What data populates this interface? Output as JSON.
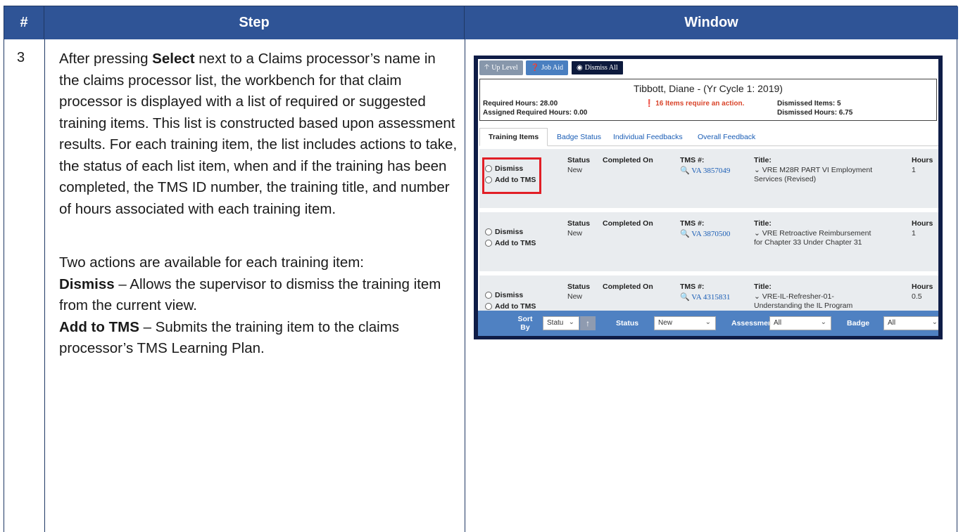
{
  "table": {
    "headers": {
      "num": "#",
      "step": "Step",
      "window": "Window"
    },
    "row_number": "3",
    "step": {
      "p1_a": "After pressing ",
      "p1_bold": "Select",
      "p1_b": " next to a Claims processor’s name in the claims processor list, the workbench for that claim processor is displayed with a list of required or suggested training items. This list is constructed based upon assessment results. For each training item, the list includes actions to take, the status of each list item, when and if the training has been completed, the TMS ID number, the training title, and number of hours associated with each training item.",
      "p2": "Two actions are available for each training item:",
      "dismiss_bold": "Dismiss",
      "dismiss_text": " – Allows the supervisor to dismiss the training item from the current view.",
      "addtms_bold": "Add to TMS",
      "addtms_text": " – Submits the training item to the claims processor’s TMS Learning Plan."
    }
  },
  "window": {
    "toolbar": {
      "up_level": "Up Level",
      "job_aid": "Job Aid",
      "dismiss_all": "Dismiss All"
    },
    "info": {
      "person": "Tibbott, Diane - (Yr Cycle 1: 2019)",
      "required_hours": "Required Hours: 28.00",
      "assigned_hours": "Assigned Required Hours: 0.00",
      "warning": "16 Items require an action.",
      "dismissed_items": "Dismissed Items: 5",
      "dismissed_hours": "Dismissed Hours: 6.75"
    },
    "tabs": [
      "Training Items",
      "Badge Status",
      "Individual Feedbacks",
      "Overall Feedback"
    ],
    "labels": {
      "dismiss": "Dismiss",
      "add_to_tms": "Add to TMS",
      "status": "Status",
      "completed_on": "Completed On",
      "tms": "TMS #:",
      "title": "Title:",
      "hours": "Hours"
    },
    "items": [
      {
        "status": "New",
        "tms": "VA 3857049",
        "title": "VRE M28R PART VI Employment Services (Revised)",
        "hours": "1"
      },
      {
        "status": "New",
        "tms": "VA 3870500",
        "title": "VRE Retroactive Reimbursement for Chapter 33 Under Chapter 31",
        "hours": "1"
      },
      {
        "status": "New",
        "tms": "VA 4315831",
        "title": "VRE-IL-Refresher-01-Understanding the IL Program",
        "hours": "0.5"
      }
    ],
    "footer": {
      "sort_by": "Sort By",
      "sort_value": "Statu",
      "status_label": "Status",
      "status_value": "New",
      "assessment_label": "Assessmen",
      "assessment_value": "All",
      "badge_label": "Badge",
      "badge_value": "All"
    },
    "colors": {
      "frame": "#0f1d47",
      "header_blue": "#2f5496",
      "highlight": "#e11e26",
      "footer": "#4f81c2"
    }
  }
}
